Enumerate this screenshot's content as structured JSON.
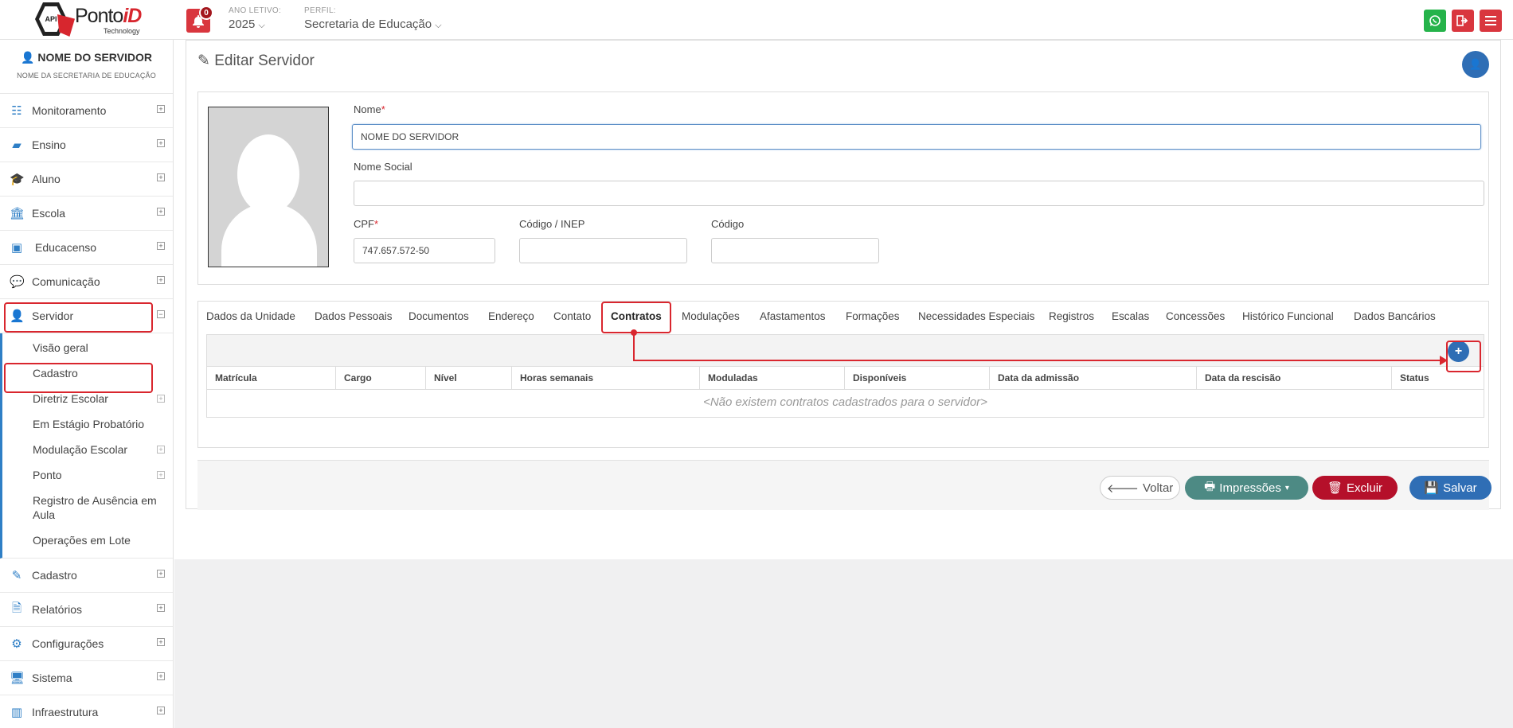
{
  "header": {
    "logo_text": "Ponto",
    "logo_accent": "iD",
    "logo_sub": "Technology",
    "logo_badge": "API",
    "notifications": "0",
    "year_label": "ANO LETIVO:",
    "year_value": "2025",
    "profile_label": "PERFIL:",
    "profile_value": "Secretaria de Educação",
    "whatsapp_icon": "whatsapp-icon",
    "logout_icon": "logout-icon",
    "menu_icon": "hamburger-icon"
  },
  "sidebar": {
    "user_name": "NOME DO SERVIDOR",
    "user_sub": "NOME DA SECRETARIA DE EDUCAÇÃO",
    "items_top": [
      {
        "label": "Monitoramento",
        "icon": "sliders-icon"
      },
      {
        "label": "Ensino",
        "icon": "book-icon"
      },
      {
        "label": "Aluno",
        "icon": "graduation-cap-icon"
      },
      {
        "label": "Escola",
        "icon": "bank-icon"
      },
      {
        "label": "Educacenso",
        "icon": "census-icon"
      },
      {
        "label": "Comunicação",
        "icon": "comment-icon"
      },
      {
        "label": "Servidor",
        "icon": "user-icon"
      }
    ],
    "sub_items": [
      {
        "label": "Visão geral"
      },
      {
        "label": "Cadastro"
      },
      {
        "label": "Diretriz Escolar"
      },
      {
        "label": "Em Estágio Probatório"
      },
      {
        "label": "Modulação Escolar"
      },
      {
        "label": "Ponto"
      },
      {
        "label": "Registro de Ausência em Aula"
      },
      {
        "label": "Operações em Lote"
      }
    ],
    "items_bottom": [
      {
        "label": "Cadastro",
        "icon": "edit-icon"
      },
      {
        "label": "Relatórios",
        "icon": "file-icon"
      },
      {
        "label": "Configurações",
        "icon": "gear-icon"
      },
      {
        "label": "Sistema",
        "icon": "monitor-icon"
      },
      {
        "label": "Infraestrutura",
        "icon": "building-icon"
      }
    ]
  },
  "page": {
    "title": "Editar Servidor",
    "fields": {
      "nome_label": "Nome",
      "nome_value": "NOME DO SERVIDOR",
      "nome_social_label": "Nome Social",
      "nome_social_value": "",
      "cpf_label": "CPF",
      "cpf_value": "747.657.572-50",
      "inep_label": "Código / INEP",
      "inep_value": "",
      "codigo_label": "Código",
      "codigo_value": ""
    },
    "tabs": [
      "Dados da Unidade",
      "Dados Pessoais",
      "Documentos",
      "Endereço",
      "Contato",
      "Contratos",
      "Modulações",
      "Afastamentos",
      "Formações",
      "Necessidades Especiais",
      "Registros",
      "Escalas",
      "Concessões",
      "Histórico Funcional",
      "Dados Bancários"
    ],
    "active_tab": "Contratos",
    "table": {
      "columns": [
        "Matrícula",
        "Cargo",
        "Nível",
        "Horas semanais",
        "Moduladas",
        "Disponíveis",
        "Data da admissão",
        "Data da rescisão",
        "Status"
      ],
      "empty_message": "<Não existem contratos cadastrados para o servidor>"
    },
    "buttons": {
      "back": "Voltar",
      "print": "Impressões",
      "delete": "Excluir",
      "save": "Salvar"
    }
  },
  "colors": {
    "primary": "#2f6eb5",
    "highlight": "#d9262e",
    "whatsapp": "#25b34a",
    "logout": "#d9363e",
    "print_btn": "#4d8a84",
    "delete_btn": "#b5102a"
  }
}
